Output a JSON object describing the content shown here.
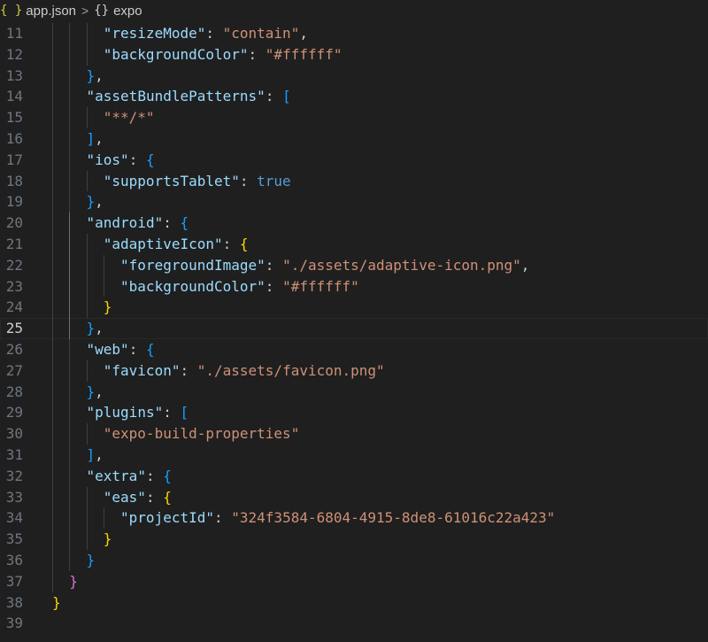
{
  "breadcrumb": {
    "file_icon": "{ }",
    "file": "app.json",
    "separator": ">",
    "symbol_icon": "{}",
    "symbol": "expo"
  },
  "editor": {
    "active_line": 25,
    "lines": [
      {
        "n": 11,
        "segs": [
          [
            "k",
            "\"resizeMode\""
          ],
          [
            "p",
            ": "
          ],
          [
            "s",
            "\"contain\""
          ],
          [
            "p",
            ","
          ]
        ]
      },
      {
        "n": 12,
        "segs": [
          [
            "k",
            "\"backgroundColor\""
          ],
          [
            "p",
            ": "
          ],
          [
            "s",
            "\"#ffffff\""
          ]
        ]
      },
      {
        "n": 13,
        "segs": [
          [
            "b3",
            "}"
          ],
          [
            "p",
            ","
          ]
        ]
      },
      {
        "n": 14,
        "segs": [
          [
            "k",
            "\"assetBundlePatterns\""
          ],
          [
            "p",
            ": "
          ],
          [
            "b3",
            "["
          ]
        ]
      },
      {
        "n": 15,
        "segs": [
          [
            "s",
            "\"**/*\""
          ]
        ]
      },
      {
        "n": 16,
        "segs": [
          [
            "b3",
            "]"
          ],
          [
            "p",
            ","
          ]
        ]
      },
      {
        "n": 17,
        "segs": [
          [
            "k",
            "\"ios\""
          ],
          [
            "p",
            ": "
          ],
          [
            "b3",
            "{"
          ]
        ]
      },
      {
        "n": 18,
        "segs": [
          [
            "k",
            "\"supportsTablet\""
          ],
          [
            "p",
            ": "
          ],
          [
            "kw",
            "true"
          ]
        ]
      },
      {
        "n": 19,
        "segs": [
          [
            "b3",
            "}"
          ],
          [
            "p",
            ","
          ]
        ]
      },
      {
        "n": 20,
        "segs": [
          [
            "k",
            "\"android\""
          ],
          [
            "p",
            ": "
          ],
          [
            "b3",
            "{"
          ]
        ]
      },
      {
        "n": 21,
        "segs": [
          [
            "k",
            "\"adaptiveIcon\""
          ],
          [
            "p",
            ": "
          ],
          [
            "b1",
            "{"
          ]
        ]
      },
      {
        "n": 22,
        "segs": [
          [
            "k",
            "\"foregroundImage\""
          ],
          [
            "p",
            ": "
          ],
          [
            "s",
            "\"./assets/adaptive-icon.png\""
          ],
          [
            "p",
            ","
          ]
        ]
      },
      {
        "n": 23,
        "segs": [
          [
            "k",
            "\"backgroundColor\""
          ],
          [
            "p",
            ": "
          ],
          [
            "s",
            "\"#ffffff\""
          ]
        ]
      },
      {
        "n": 24,
        "segs": [
          [
            "b1",
            "}"
          ]
        ]
      },
      {
        "n": 25,
        "segs": [
          [
            "b3",
            "}"
          ],
          [
            "p",
            ","
          ]
        ]
      },
      {
        "n": 26,
        "segs": [
          [
            "k",
            "\"web\""
          ],
          [
            "p",
            ": "
          ],
          [
            "b3",
            "{"
          ]
        ]
      },
      {
        "n": 27,
        "segs": [
          [
            "k",
            "\"favicon\""
          ],
          [
            "p",
            ": "
          ],
          [
            "s",
            "\"./assets/favicon.png\""
          ]
        ]
      },
      {
        "n": 28,
        "segs": [
          [
            "b3",
            "}"
          ],
          [
            "p",
            ","
          ]
        ]
      },
      {
        "n": 29,
        "segs": [
          [
            "k",
            "\"plugins\""
          ],
          [
            "p",
            ": "
          ],
          [
            "b3",
            "["
          ]
        ]
      },
      {
        "n": 30,
        "segs": [
          [
            "s",
            "\"expo-build-properties\""
          ]
        ]
      },
      {
        "n": 31,
        "segs": [
          [
            "b3",
            "]"
          ],
          [
            "p",
            ","
          ]
        ]
      },
      {
        "n": 32,
        "segs": [
          [
            "k",
            "\"extra\""
          ],
          [
            "p",
            ": "
          ],
          [
            "b3",
            "{"
          ]
        ]
      },
      {
        "n": 33,
        "segs": [
          [
            "k",
            "\"eas\""
          ],
          [
            "p",
            ": "
          ],
          [
            "b1",
            "{"
          ]
        ]
      },
      {
        "n": 34,
        "segs": [
          [
            "k",
            "\"projectId\""
          ],
          [
            "p",
            ": "
          ],
          [
            "s",
            "\"324f3584-6804-4915-8de8-61016c22a423\""
          ]
        ]
      },
      {
        "n": 35,
        "segs": [
          [
            "b1",
            "}"
          ]
        ]
      },
      {
        "n": 36,
        "segs": [
          [
            "b3",
            "}"
          ]
        ]
      },
      {
        "n": 37,
        "segs": [
          [
            "b2",
            "}"
          ]
        ]
      },
      {
        "n": 38,
        "segs": [
          [
            "b1",
            "}"
          ]
        ]
      },
      {
        "n": 39,
        "segs": []
      }
    ]
  }
}
